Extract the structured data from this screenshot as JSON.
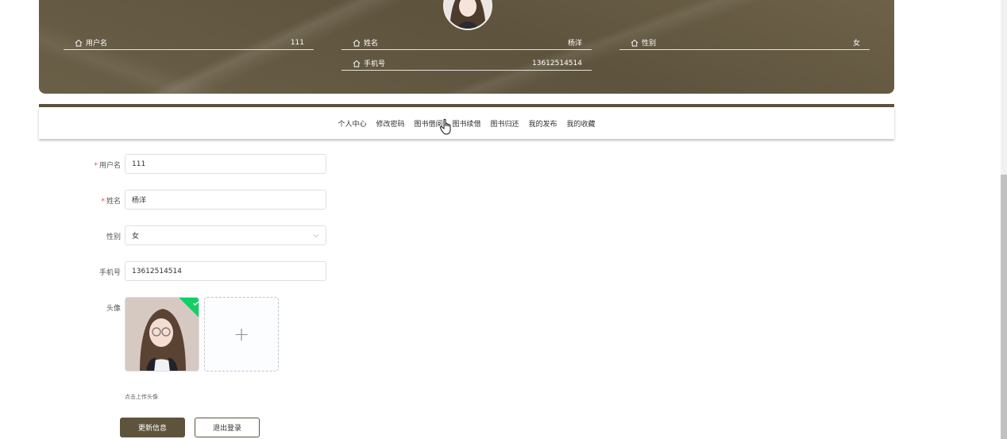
{
  "profile_header": {
    "fields": [
      {
        "label": "用户名",
        "value": "111"
      },
      {
        "label": "姓名",
        "value": "杨洋"
      },
      {
        "label": "性别",
        "value": "女"
      },
      {
        "label": "手机号",
        "value": "13612514514"
      }
    ]
  },
  "nav": {
    "items": [
      "个人中心",
      "修改密码",
      "图书借阅",
      "图书续借",
      "图书归还",
      "我的发布",
      "我的收藏"
    ]
  },
  "form": {
    "username": {
      "label": "用户名",
      "value": "111",
      "required": true
    },
    "name": {
      "label": "姓名",
      "value": "杨洋",
      "required": true
    },
    "gender": {
      "label": "性别",
      "value": "女"
    },
    "phone": {
      "label": "手机号",
      "value": "13612514514"
    },
    "avatar": {
      "label": "头像",
      "add_symbol": "+",
      "tip": "点击上传头像"
    }
  },
  "buttons": {
    "update": "更新信息",
    "logout": "退出登录"
  },
  "colors": {
    "brand": "#5e533d",
    "required": "#e24a4a",
    "success": "#13ce66"
  }
}
